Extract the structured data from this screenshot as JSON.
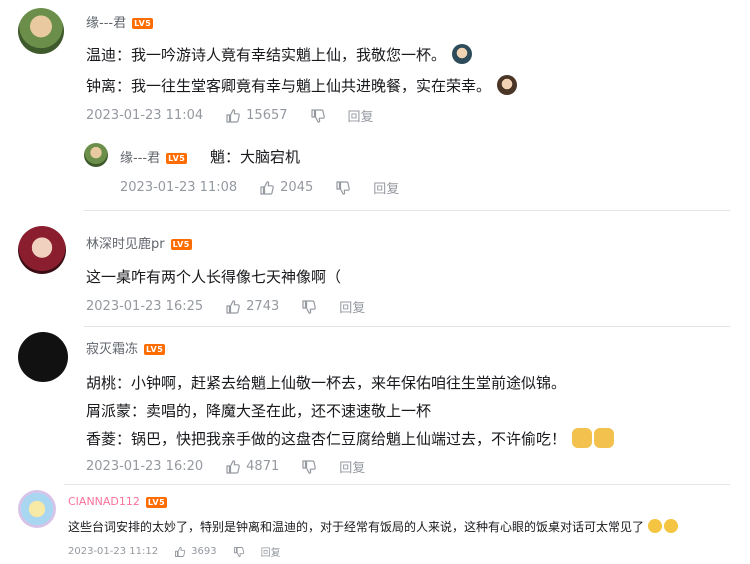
{
  "comments": [
    {
      "user": "缘---君",
      "level": "LV5",
      "lines": [
        "温迪：我一吟游诗人竟有幸结实魈上仙，我敬您一杯。",
        "钟离：我一往生堂客卿竟有幸与魈上仙共进晚餐，实在荣幸。"
      ],
      "time": "2023-01-23 11:04",
      "likes": "15657",
      "reply_label": "回复",
      "reply": {
        "user": "缘---君",
        "level": "LV5",
        "text": "魈：大脑宕机",
        "time": "2023-01-23 11:08",
        "likes": "2045",
        "reply_label": "回复"
      }
    },
    {
      "user": "林深时见鹿pr",
      "level": "LV5",
      "lines": [
        "这一桌咋有两个人长得像七天神像啊（"
      ],
      "time": "2023-01-23 16:25",
      "likes": "2743",
      "reply_label": "回复"
    },
    {
      "user": "寂灭霜冻",
      "level": "LV5",
      "lines": [
        "胡桃：小钟啊，赶紧去给魈上仙敬一杯去，来年保佑咱往生堂前途似锦。",
        "屑派蒙：卖唱的，降魔大圣在此，还不速速敬上一杯",
        "香菱：锅巴，快把我亲手做的这盘杏仁豆腐给魈上仙端过去，不许偷吃！"
      ],
      "time": "2023-01-23 16:20",
      "likes": "4871",
      "reply_label": "回复"
    },
    {
      "user": "CIANNAD112",
      "level": "LV5",
      "lines": [
        "这些台词安排的太妙了，特别是钟离和温迪的，对于经常有饭局的人来说，这种有心眼的饭桌对话可太常见了"
      ],
      "time": "2023-01-23 11:12",
      "likes": "3693",
      "reply_label": "回复"
    }
  ],
  "colors": {
    "username": "#61666d",
    "username_vip": "#fb7299",
    "meta": "#9499a0",
    "level_badge": "#ff6c00"
  },
  "icons": [
    "thumb-up-icon",
    "thumb-down-icon"
  ]
}
